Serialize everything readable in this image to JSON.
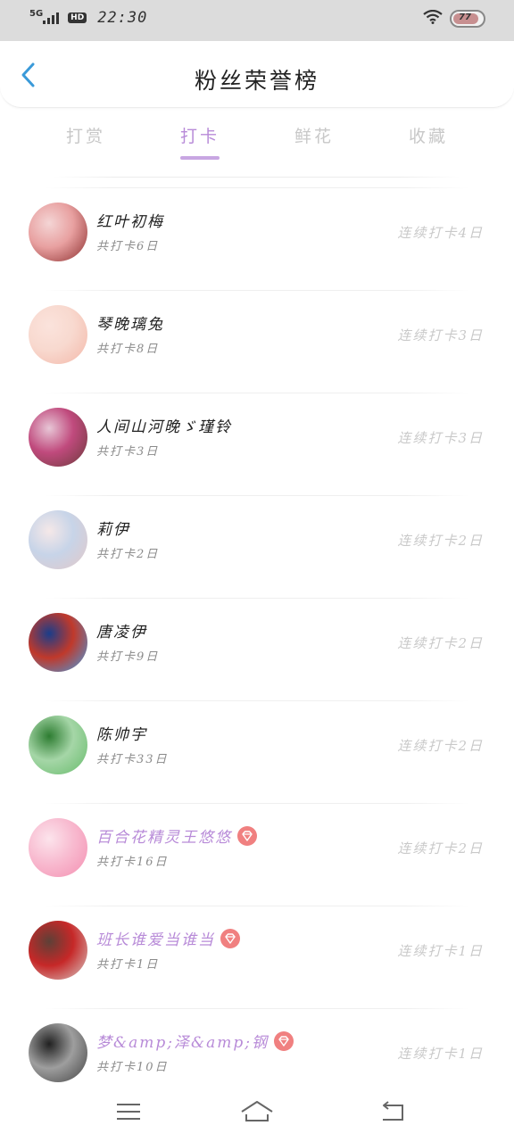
{
  "status_bar": {
    "network": "5G",
    "hd": "HD",
    "time": "22:30",
    "battery": "77"
  },
  "header": {
    "title": "粉丝荣誉榜"
  },
  "tabs": [
    {
      "label": "打赏",
      "active": false
    },
    {
      "label": "打卡",
      "active": true
    },
    {
      "label": "鲜花",
      "active": false
    },
    {
      "label": "收藏",
      "active": false
    }
  ],
  "rows": [
    {
      "name": "红叶初梅",
      "total": "共打卡6日",
      "streak": "连续打卡4日",
      "vip": false,
      "avatar_colors": [
        "#f4d5d5",
        "#8b2d2d",
        "#e8a0a0"
      ]
    },
    {
      "name": "琴晚璃兔",
      "total": "共打卡8日",
      "streak": "连续打卡3日",
      "vip": false,
      "avatar_colors": [
        "#fbe3dc",
        "#f3b7a8",
        "#f8d9cf"
      ]
    },
    {
      "name": "人间山河晚ゞ瑾铃",
      "total": "共打卡3日",
      "streak": "连续打卡3日",
      "vip": false,
      "avatar_colors": [
        "#e7c6d6",
        "#6b3a3a",
        "#c04a7d"
      ]
    },
    {
      "name": "莉伊",
      "total": "共打卡2日",
      "streak": "连续打卡2日",
      "vip": false,
      "avatar_colors": [
        "#f5e8e8",
        "#e3c8c8",
        "#c7d4e8"
      ]
    },
    {
      "name": "唐凌伊",
      "total": "共打卡9日",
      "streak": "连续打卡2日",
      "vip": false,
      "avatar_colors": [
        "#1a3d8a",
        "#3fa0e8",
        "#c0392b"
      ]
    },
    {
      "name": "陈帅宇",
      "total": "共打卡33日",
      "streak": "连续打卡2日",
      "vip": false,
      "avatar_colors": [
        "#2e7d32",
        "#66bb6a",
        "#a5d6a7"
      ]
    },
    {
      "name": "百合花精灵王悠悠",
      "total": "共打卡16日",
      "streak": "连续打卡2日",
      "vip": true,
      "avatar_colors": [
        "#fce4ec",
        "#f48fb1",
        "#f8bbd0"
      ]
    },
    {
      "name": "班长谁爱当谁当",
      "total": "共打卡1日",
      "streak": "连续打卡1日",
      "vip": true,
      "avatar_colors": [
        "#5d4037",
        "#d7ccc8",
        "#c62828"
      ]
    },
    {
      "name": "梦&amp;泽&amp;钢",
      "total": "共打卡10日",
      "streak": "连续打卡1日",
      "vip": true,
      "avatar_colors": [
        "#212121",
        "#424242",
        "#9e9e9e"
      ]
    }
  ],
  "colors": {
    "accent": "#b88bd8",
    "vip_badge": "#f08080",
    "back_arrow": "#3a9ad9"
  }
}
